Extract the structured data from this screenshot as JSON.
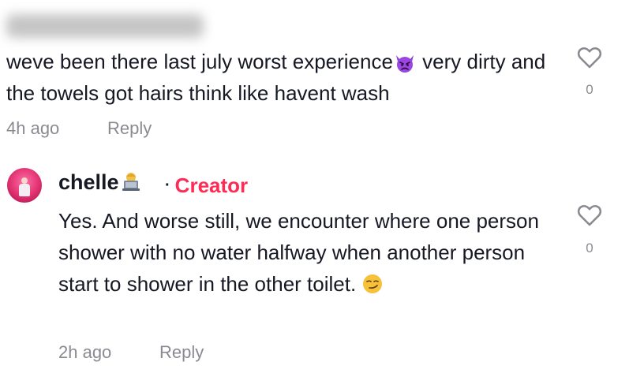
{
  "comment1": {
    "text_part1": "weve been there last july worst experience",
    "emoji": "angry-devil-emoji",
    "text_part2": " very dirty and the towels got hairs think like havent wash",
    "time": "4h ago",
    "reply_label": "Reply",
    "like_count": "0"
  },
  "comment2": {
    "username": "chelle",
    "username_emoji": "person-at-laptop-emoji",
    "separator": "·",
    "badge": "Creator",
    "text": "Yes. And worse still, we encounter where one person shower with no water halfway when another person start to shower in the other toilet. ",
    "text_emoji": "smirking-face-emoji",
    "time": "2h ago",
    "reply_label": "Reply",
    "like_count": "0"
  },
  "colors": {
    "creator_badge": "#fe2c55",
    "meta_text": "#8a8b91",
    "primary_text": "#161823",
    "heart_outline": "#8a8b91"
  }
}
